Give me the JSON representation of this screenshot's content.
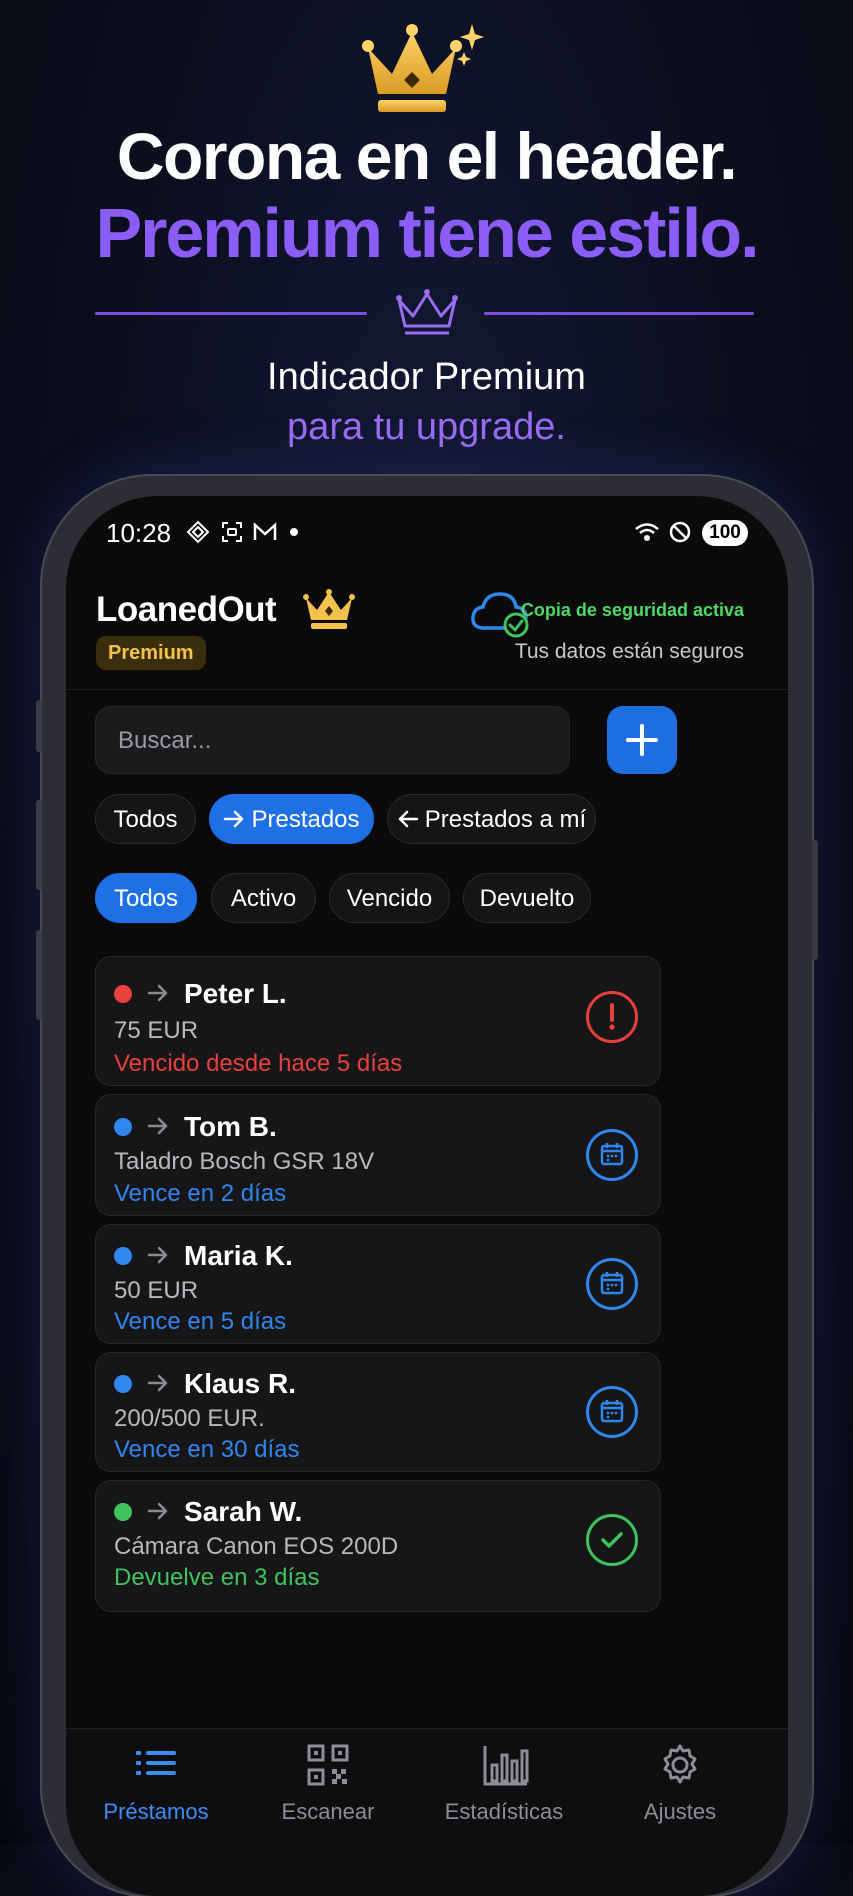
{
  "hero": {
    "headline": "Corona en el header.",
    "headline_accent": "Premium tiene estilo.",
    "subtitle": "Indicador Premium",
    "subtitle_accent": "para tu upgrade."
  },
  "status_bar": {
    "time": "10:28",
    "battery": "100"
  },
  "header": {
    "app_title": "LoanedOut",
    "premium_badge": "Premium",
    "backup_status": "Copia de seguridad activa",
    "backup_subtitle": "Tus datos están seguros"
  },
  "search": {
    "placeholder": "Buscar..."
  },
  "direction_filters": [
    {
      "label": "Todos",
      "active": false
    },
    {
      "label": "Prestados",
      "active": true,
      "icon": "arrow-right-icon"
    },
    {
      "label": "Prestados a mí",
      "active": false,
      "icon": "arrow-left-icon"
    }
  ],
  "status_filters": [
    {
      "label": "Todos",
      "active": true
    },
    {
      "label": "Activo",
      "active": false
    },
    {
      "label": "Vencido",
      "active": false
    },
    {
      "label": "Devuelto",
      "active": false
    }
  ],
  "loans": [
    {
      "name": "Peter L.",
      "detail": "75 EUR",
      "status": "Vencido desde hace 5 días",
      "color": "#e8403a",
      "icon": "alert-icon"
    },
    {
      "name": "Tom B.",
      "detail": "Taladro Bosch GSR 18V",
      "status": "Vence en 2 días",
      "color": "#2f86ef",
      "icon": "calendar-icon"
    },
    {
      "name": "Maria K.",
      "detail": "50 EUR",
      "status": "Vence en 5 días",
      "color": "#2f86ef",
      "icon": "calendar-icon"
    },
    {
      "name": "Klaus R.",
      "detail": "200/500 EUR.",
      "status": "Vence en 30 días",
      "color": "#2f86ef",
      "icon": "calendar-icon"
    },
    {
      "name": "Sarah W.",
      "detail": "Cámara Canon EOS 200D",
      "status": "Devuelve en 3 días",
      "color": "#3fc35a",
      "icon": "check-icon"
    }
  ],
  "tabs": [
    {
      "label": "Préstamos",
      "icon": "list-icon",
      "active": true
    },
    {
      "label": "Escanear",
      "icon": "qr-icon",
      "active": false
    },
    {
      "label": "Estadísticas",
      "icon": "chart-icon",
      "active": false
    },
    {
      "label": "Ajustes",
      "icon": "gear-icon",
      "active": false
    }
  ],
  "colors": {
    "accent": "#1f6fe5",
    "premium_gold": "#f2c14e",
    "headline_purple": "#8b5cf6"
  }
}
